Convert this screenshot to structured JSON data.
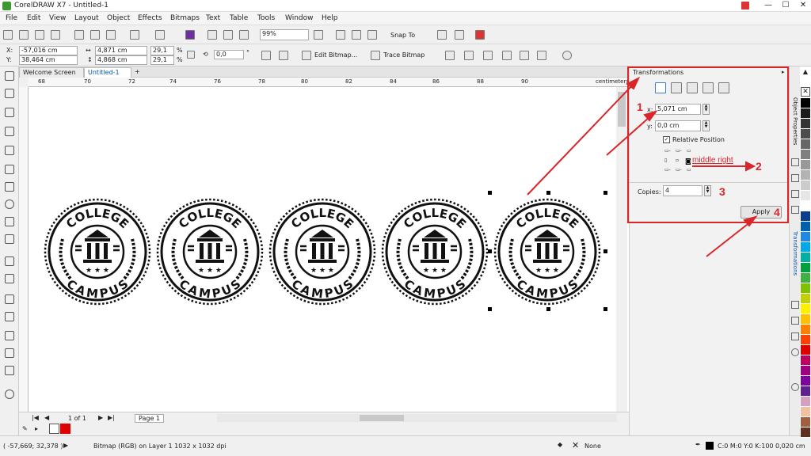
{
  "window": {
    "title": "CorelDRAW X7 - Untitled-1",
    "min": "—",
    "max": "☐",
    "close": "✕"
  },
  "menu": [
    "File",
    "Edit",
    "View",
    "Layout",
    "Object",
    "Effects",
    "Bitmaps",
    "Text",
    "Table",
    "Tools",
    "Window",
    "Help"
  ],
  "stdbar": {
    "zoom": "99%",
    "snap_to": "Snap To"
  },
  "propbar": {
    "x_label": "X:",
    "x_value": "-57,016 cm",
    "y_label": "Y:",
    "y_value": "38,464 cm",
    "w_value": "4,871 cm",
    "h_value": "4,868 cm",
    "sw_value": "29,1",
    "sh_value": "29,1",
    "pct": "%",
    "angle_value": "0,0",
    "deg": "°",
    "edit_bitmap": "Edit Bitmap...",
    "trace_bitmap": "Trace Bitmap"
  },
  "tabs": {
    "welcome": "Welcome Screen",
    "doc": "Untitled-1",
    "add": "+"
  },
  "ruler": {
    "ticks": [
      "68",
      "70",
      "72",
      "74",
      "76",
      "78",
      "80",
      "82",
      "84",
      "86",
      "88",
      "90"
    ],
    "unit": "centimeters"
  },
  "badges": [
    {
      "top": "COLLEGE",
      "bottom": "CAMPUS"
    },
    {
      "top": "COLLEGE",
      "bottom": "CAMPUS"
    },
    {
      "top": "COLLEGE",
      "bottom": "CAMPUS"
    },
    {
      "top": "COLLEGE",
      "bottom": "CAMPUS"
    },
    {
      "top": "COLLEGE",
      "bottom": "CAMPUS"
    }
  ],
  "pagebar": {
    "pages": "1 of 1",
    "page_tab": "Page 1"
  },
  "status": {
    "coords": "( -57,669; 32,378 )",
    "info": "Bitmap (RGB) on Layer 1 1032 x 1032 dpi",
    "fill": "None",
    "outline": "C:0 M:0 Y:0 K:100  0,020 cm"
  },
  "docker": {
    "title": "Transformations",
    "x_label": "x:",
    "x_value": "5,071 cm",
    "y_label": "y:",
    "y_value": "0,0 cm",
    "relative": "Relative Position",
    "copies_label": "Copies:",
    "copies_value": "4",
    "apply": "Apply"
  },
  "dock_tabs": {
    "object_props": "Object Properties",
    "transformations": "Transformations"
  },
  "annotations": {
    "n1": "1",
    "n2": "2",
    "n3": "3",
    "n4": "4",
    "middle": "middle right",
    "color": "#d9262b"
  },
  "palette": [
    "#000000",
    "#1a1a1a",
    "#333333",
    "#4d4d4d",
    "#666666",
    "#808080",
    "#999999",
    "#b3b3b3",
    "#cccccc",
    "#e6e6e6",
    "#ffffff",
    "#0b3d91",
    "#0060b0",
    "#1e88e5",
    "#00a8e8",
    "#00b0a0",
    "#00a040",
    "#40b040",
    "#80c000",
    "#c0d000",
    "#fff000",
    "#ffc000",
    "#ff8000",
    "#ff4000",
    "#e00000",
    "#c00060",
    "#a00080",
    "#8000a0",
    "#602090",
    "#d8a0c0",
    "#f0c0a0",
    "#a06040",
    "#603020"
  ]
}
